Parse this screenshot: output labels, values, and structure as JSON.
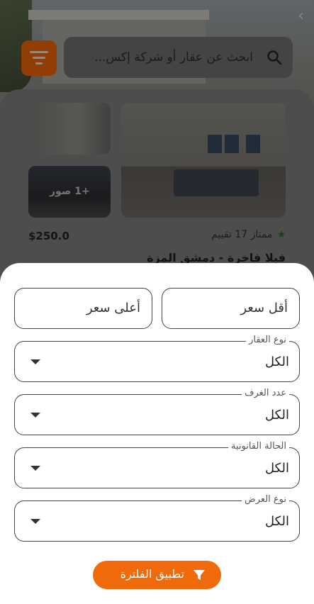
{
  "search": {
    "placeholder": "ابحث عن عقار أو شركة إكس..."
  },
  "listing": {
    "more_photos": "+1 صور",
    "price": "$250.0",
    "rating_text": "ممتاز 17 تقييم",
    "title": "فيلا فاخرة - دمشق المزة"
  },
  "filters": {
    "min_price_placeholder": "أقل سعر",
    "max_price_placeholder": "أعلى سعر",
    "dropdowns": [
      {
        "label": "نوع العقار",
        "value": "الكل"
      },
      {
        "label": "عدد الغرف",
        "value": "الكل"
      },
      {
        "label": "الحالة القانونية",
        "value": "الكل"
      },
      {
        "label": "نوع العرض",
        "value": "الكل"
      }
    ],
    "apply_label": "تطبيق الفلترة"
  },
  "colors": {
    "accent": "#f06a0c",
    "rating_star": "#1d6b35"
  },
  "icons": [
    "search-icon",
    "filter-lines-icon",
    "funnel-icon",
    "chevron-right-icon",
    "star-icon",
    "dropdown-arrow-icon"
  ]
}
